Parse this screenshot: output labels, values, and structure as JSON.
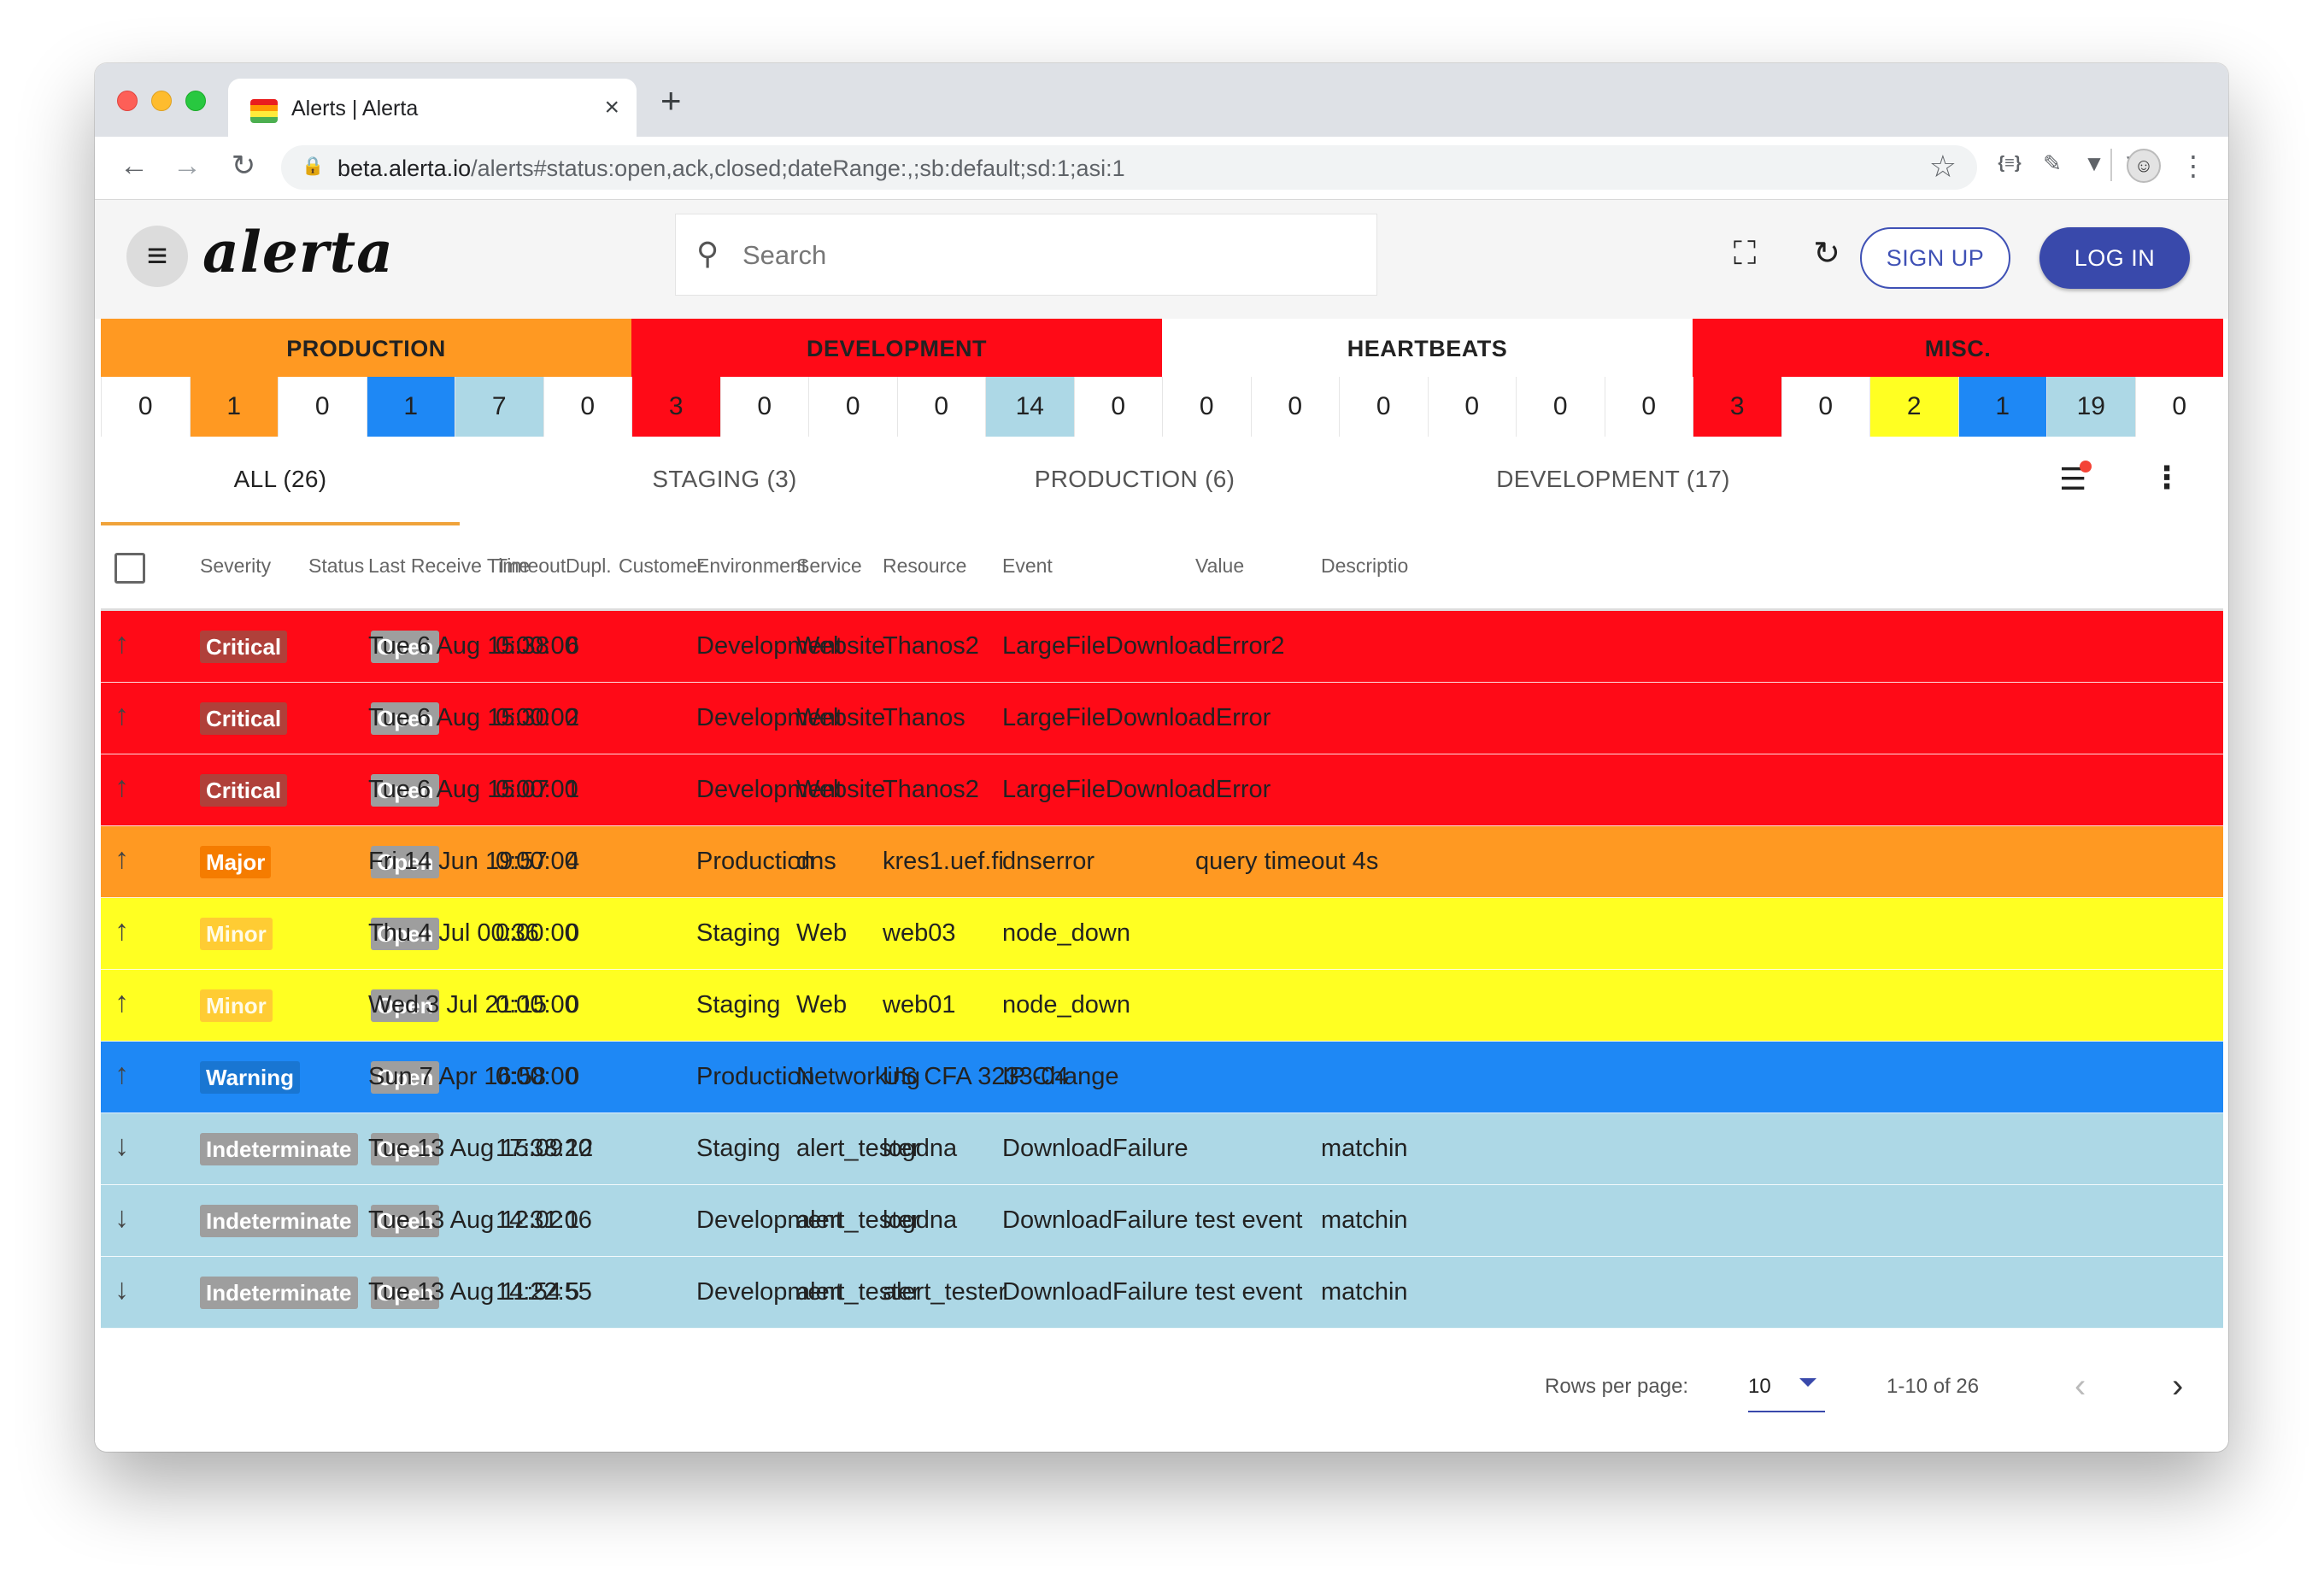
{
  "browser": {
    "tab_title": "Alerts | Alerta",
    "url_host": "beta.alerta.io",
    "url_path": "/alerts#status:open,ack,closed;dateRange:,;sb:default;sd:1;asi:1"
  },
  "header": {
    "logo": "alerta",
    "search_placeholder": "Search",
    "signup_label": "SIGN UP",
    "login_label": "LOG IN"
  },
  "environments": [
    {
      "name": "PRODUCTION",
      "color": "#ff9922",
      "counts": [
        "0",
        "1",
        "0",
        "1",
        "7",
        "0"
      ]
    },
    {
      "name": "DEVELOPMENT",
      "color": "#ff0a17",
      "counts": [
        "3",
        "0",
        "0",
        "0",
        "14",
        "0"
      ]
    },
    {
      "name": "HEARTBEATS",
      "color": "#ffffff",
      "counts": [
        "0",
        "0",
        "0",
        "0",
        "0",
        "0"
      ]
    },
    {
      "name": "MISC.",
      "color": "#ff0a17",
      "counts": [
        "3",
        "0",
        "2",
        "1",
        "19",
        "0"
      ]
    }
  ],
  "tabs": [
    {
      "label": "ALL (26)"
    },
    {
      "label": "STAGING (3)"
    },
    {
      "label": "PRODUCTION (6)"
    },
    {
      "label": "DEVELOPMENT (17)"
    }
  ],
  "columns": [
    "Severity",
    "Status",
    "Last Receive Time",
    "Timeout",
    "Dupl.",
    "Customer",
    "Environment",
    "Service",
    "Resource",
    "Event",
    "Value",
    "Descriptio"
  ],
  "rows": [
    {
      "trend": "↑",
      "severity": "Critical",
      "status": "Open",
      "time": "Tue 6 Aug 15:38",
      "timeout": "0:00:00",
      "dupl": "6",
      "customer": "",
      "environment": "Development",
      "service": "Website",
      "resource": "Thanos2",
      "event": "LargeFileDownloadError2",
      "value": "",
      "description": ""
    },
    {
      "trend": "↑",
      "severity": "Critical",
      "status": "Open",
      "time": "Tue 6 Aug 15:30",
      "timeout": "0:00:00",
      "dupl": "2",
      "customer": "",
      "environment": "Development",
      "service": "Website",
      "resource": "Thanos",
      "event": "LargeFileDownloadError",
      "value": "",
      "description": ""
    },
    {
      "trend": "↑",
      "severity": "Critical",
      "status": "Open",
      "time": "Tue 6 Aug 15:07",
      "timeout": "0:00:00",
      "dupl": "1",
      "customer": "",
      "environment": "Development",
      "service": "Website",
      "resource": "Thanos2",
      "event": "LargeFileDownloadError",
      "value": "",
      "description": ""
    },
    {
      "trend": "↑",
      "severity": "Major",
      "status": "Open",
      "time": "Fri 14 Jun 19:57",
      "timeout": "0:00:00",
      "dupl": "4",
      "customer": "",
      "environment": "Production",
      "service": "dns",
      "resource": "kres1.uef.fi",
      "event": "dnserror",
      "value": "query timeout 4s",
      "description": ""
    },
    {
      "trend": "↑",
      "severity": "Minor",
      "status": "Open",
      "time": "Thu 4 Jul 00:36",
      "timeout": "0:00:00",
      "dupl": "0",
      "customer": "",
      "environment": "Staging",
      "service": "Web",
      "resource": "web03",
      "event": "node_down",
      "value": "",
      "description": ""
    },
    {
      "trend": "↑",
      "severity": "Minor",
      "status": "Open",
      "time": "Wed 3 Jul 21:15",
      "timeout": "0:00:00",
      "dupl": "0",
      "customer": "",
      "environment": "Staging",
      "service": "Web",
      "resource": "web01",
      "event": "node_down",
      "value": "",
      "description": ""
    },
    {
      "trend": "↑",
      "severity": "Warning",
      "status": "Open",
      "time": "Sun 7 Apr 16:58",
      "timeout": "0:00:00",
      "dupl": "0",
      "customer": "",
      "environment": "Production",
      "service": "Networking",
      "resource": "US CFA 3233-04",
      "event": "IP Change",
      "value": "",
      "description": ""
    },
    {
      "trend": "↓",
      "severity": "Indeterminate",
      "status": "Open",
      "time": "Tue 13 Aug 15:09",
      "timeout": "17:38:20",
      "dupl": "12",
      "customer": "",
      "environment": "Staging",
      "service": "alert_tester",
      "resource": "logdna",
      "event": "DownloadFailure",
      "value": "",
      "description": "matchin"
    },
    {
      "trend": "↓",
      "severity": "Indeterminate",
      "status": "Open",
      "time": "Tue 13 Aug 12:02",
      "timeout": "14:31:06",
      "dupl": "1",
      "customer": "",
      "environment": "Development",
      "service": "alert_tester",
      "resource": "logdna",
      "event": "DownloadFailure test event",
      "value": "",
      "description": "matchin"
    },
    {
      "trend": "↓",
      "severity": "Indeterminate",
      "status": "Open",
      "time": "Tue 13 Aug 11:54",
      "timeout": "14:22:55",
      "dupl": "5",
      "customer": "",
      "environment": "Development",
      "service": "alert_tester",
      "resource": "alert_tester",
      "event": "DownloadFailure test event",
      "value": "",
      "description": "matchin"
    }
  ],
  "severity_colors": {
    "Critical": "#ff0a17",
    "Major": "#ff9922",
    "Minor": "#ffff22",
    "Warning": "#1e88f5",
    "Indeterminate": "#add8e6"
  },
  "pagination": {
    "rows_per_page_label": "Rows per page:",
    "rows_per_page": "10",
    "range": "1-10 of 26"
  }
}
